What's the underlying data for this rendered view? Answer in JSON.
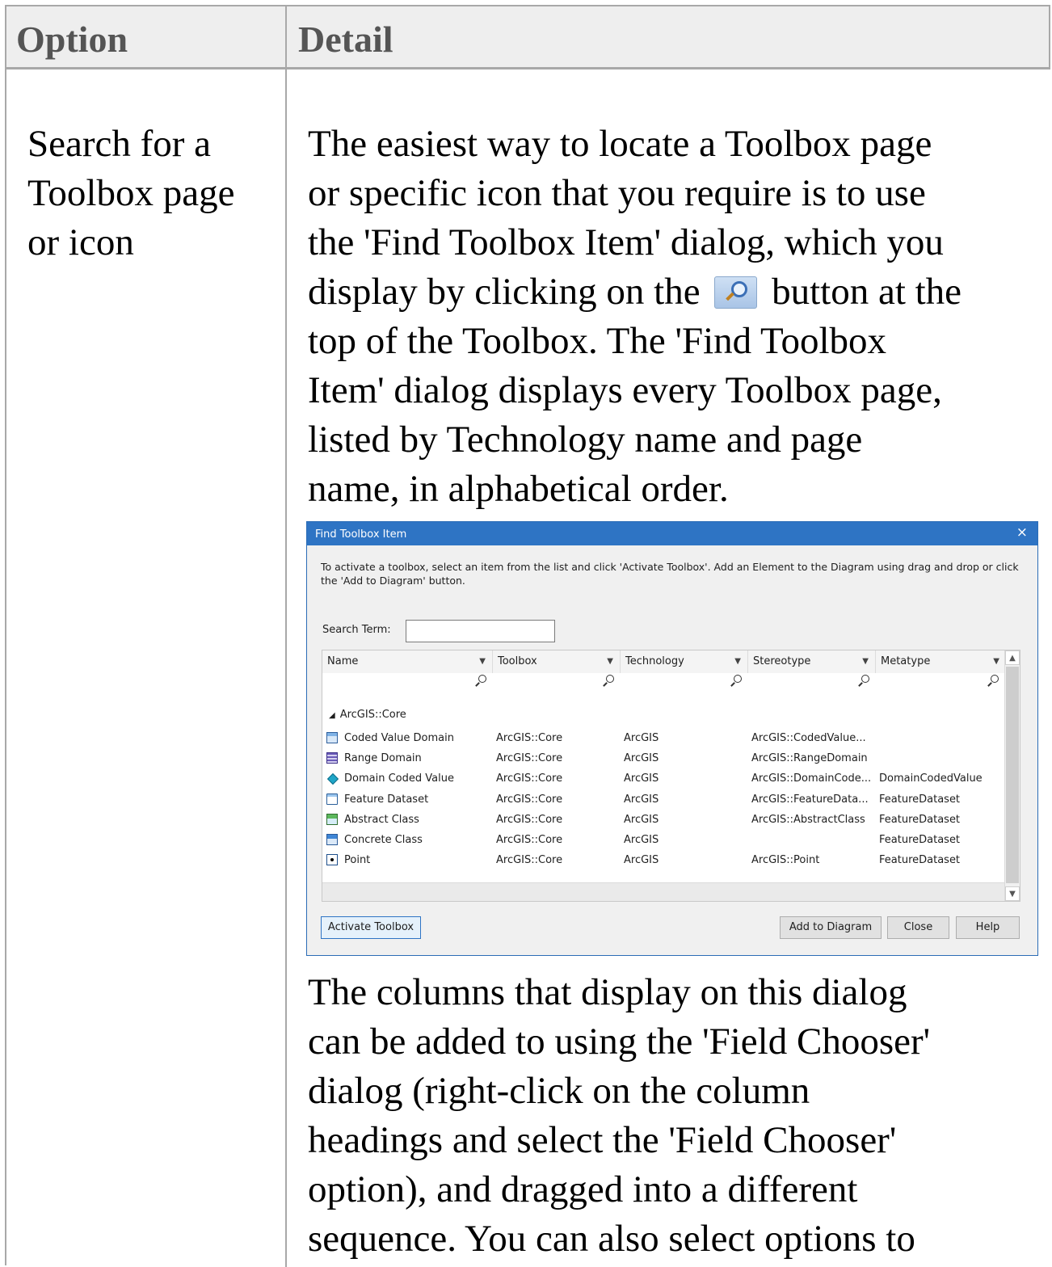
{
  "table": {
    "headers": [
      "Option",
      "Detail"
    ],
    "option": [
      "Search for a",
      "Toolbox page",
      "or icon"
    ],
    "detail_p1": [
      "The easiest way to locate a Toolbox page",
      "or specific icon that you require is to use",
      "the 'Find Toolbox Item' dialog, which you",
      "display by clicking on the",
      "button at the",
      "top of the Toolbox. The 'Find Toolbox",
      "Item' dialog displays every Toolbox page,",
      "listed by Technology name and page",
      "name, in alphabetical order."
    ],
    "detail_p2": [
      "The columns that display on this dialog",
      "can be added to using the 'Field Chooser'",
      "dialog (right-click on the column",
      "headings and select the 'Field Chooser'",
      "option), and dragged into a different",
      "sequence. You can also select options to"
    ]
  },
  "dialog": {
    "title": "Find Toolbox Item",
    "close_glyph": "×",
    "instructions": "To activate a toolbox, select an item from the list and click 'Activate Toolbox'. Add an Element to the Diagram using drag and drop or click the 'Add to Diagram' button.",
    "search_label": "Search Term:",
    "search_value": "",
    "columns": [
      "Name",
      "Toolbox",
      "Technology",
      "Stereotype",
      "Metatype"
    ],
    "group": "ArcGIS::Core",
    "rows": [
      {
        "icon": "coded-value-domain-icon",
        "name": "Coded Value Domain",
        "toolbox": "ArcGIS::Core",
        "technology": "ArcGIS",
        "stereotype": "ArcGIS::CodedValue...",
        "metatype": ""
      },
      {
        "icon": "range-domain-icon",
        "name": "Range Domain",
        "toolbox": "ArcGIS::Core",
        "technology": "ArcGIS",
        "stereotype": "ArcGIS::RangeDomain",
        "metatype": ""
      },
      {
        "icon": "domain-coded-value-icon",
        "name": "Domain Coded Value",
        "toolbox": "ArcGIS::Core",
        "technology": "ArcGIS",
        "stereotype": "ArcGIS::DomainCode...",
        "metatype": "DomainCodedValue"
      },
      {
        "icon": "feature-dataset-icon",
        "name": "Feature Dataset",
        "toolbox": "ArcGIS::Core",
        "technology": "ArcGIS",
        "stereotype": "ArcGIS::FeatureData...",
        "metatype": "FeatureDataset"
      },
      {
        "icon": "abstract-class-icon",
        "name": "Abstract Class",
        "toolbox": "ArcGIS::Core",
        "technology": "ArcGIS",
        "stereotype": "ArcGIS::AbstractClass",
        "metatype": "FeatureDataset"
      },
      {
        "icon": "concrete-class-icon",
        "name": "Concrete Class",
        "toolbox": "ArcGIS::Core",
        "technology": "ArcGIS",
        "stereotype": "",
        "metatype": "FeatureDataset"
      },
      {
        "icon": "point-icon",
        "name": "Point",
        "toolbox": "ArcGIS::Core",
        "technology": "ArcGIS",
        "stereotype": "ArcGIS::Point",
        "metatype": "FeatureDataset"
      }
    ],
    "buttons": {
      "activate": "Activate Toolbox",
      "add": "Add to Diagram",
      "close": "Close",
      "help": "Help"
    }
  }
}
